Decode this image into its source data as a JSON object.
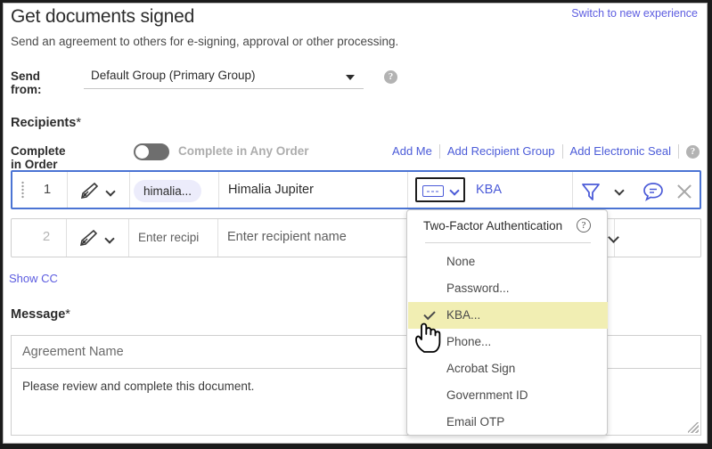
{
  "header": {
    "title": "Get documents signed",
    "subtitle": "Send an agreement to others for e-signing, approval or other processing.",
    "switch_link": "Switch to new experience"
  },
  "send_from": {
    "label": "Send from:",
    "value": "Default Group (Primary Group)",
    "help_glyph": "?",
    "caret_icon": "caret-down-icon"
  },
  "recipients": {
    "section_title": "Recipients",
    "required_mark": "*",
    "order_toggle": {
      "on_label": "Complete in Order",
      "off_label": "Complete in Any Order",
      "state": "off"
    },
    "actions": [
      {
        "label": "Add Me"
      },
      {
        "label": "Add Recipient Group"
      },
      {
        "label": "Add Electronic Seal"
      }
    ],
    "help_glyph": "?",
    "rows": [
      {
        "number": "1",
        "role_icon": "signature-pen-icon",
        "email_chip": "himalia...",
        "name": "Himalia Jupiter",
        "auth_method": "KBA",
        "auth_icon": "two-factor-code-icon",
        "filter_icon": "funnel-icon",
        "message_icon": "chat-bubble-icon",
        "remove_icon": "close-x-icon"
      },
      {
        "number": "2",
        "role_icon": "signature-pen-icon",
        "email_placeholder": "Enter recipi",
        "name_placeholder": "Enter recipient name"
      }
    ],
    "show_cc": "Show CC"
  },
  "auth_dropdown": {
    "header": "Two-Factor Authentication",
    "help_glyph": "?",
    "items": [
      {
        "label": "None",
        "selected": false
      },
      {
        "label": "Password...",
        "selected": false
      },
      {
        "label": "KBA...",
        "selected": true
      },
      {
        "label": "Phone...",
        "selected": false
      },
      {
        "label": "Acrobat Sign",
        "selected": false
      },
      {
        "label": "Government ID",
        "selected": false
      },
      {
        "label": "Email OTP",
        "selected": false
      }
    ],
    "highlight_color": "#f1eeb3",
    "cursor_icon": "hand-pointer-cursor"
  },
  "message": {
    "section_title": "Message",
    "required_mark": "*",
    "agreement_name_placeholder": "Agreement Name",
    "body_text": "Please review and complete this document.",
    "resize_icon": "resize-grip-icon"
  },
  "colors": {
    "link": "#4b5bd8",
    "accent_border": "#4b74d4",
    "chip_bg": "#ececfb"
  }
}
